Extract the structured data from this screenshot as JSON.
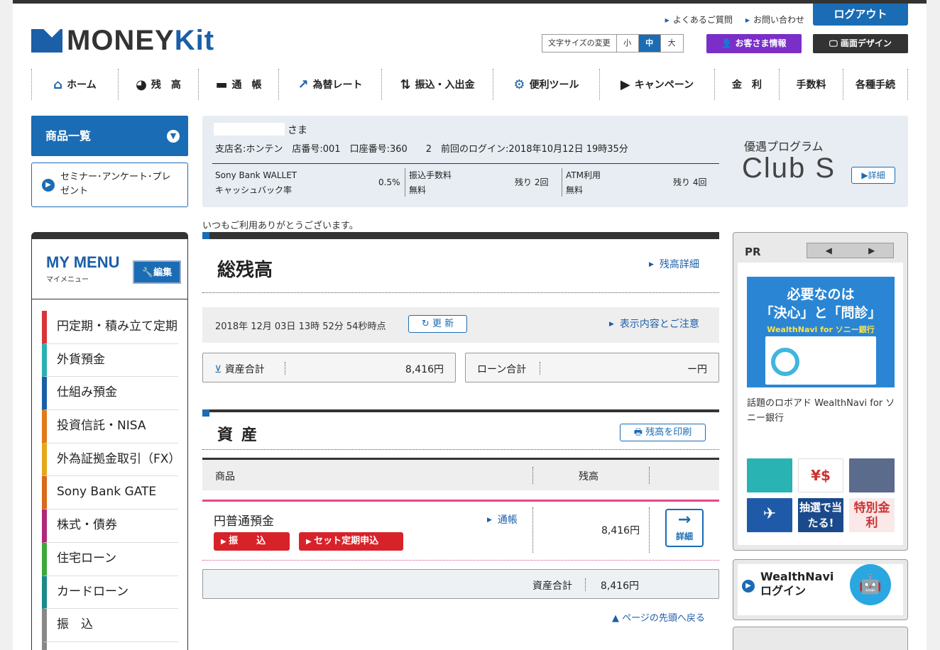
{
  "header": {
    "logo_money": "MONEY",
    "logo_kit": "Kit",
    "top_links": [
      "よくあるご質問",
      "お問い合わせ"
    ],
    "logout": "ログアウト",
    "font_size_label": "文字サイズの変更",
    "font_size_options": [
      "小",
      "中",
      "大"
    ],
    "font_size_selected": "中",
    "customer_info": "お客さま情報",
    "screen_design": "画面デザイン"
  },
  "nav": [
    {
      "label": "ホーム",
      "icon": "home-icon",
      "glyph": "⌂"
    },
    {
      "label": "残　高",
      "icon": "pie-chart-icon",
      "glyph": "◕"
    },
    {
      "label": "通　帳",
      "icon": "passbook-icon",
      "glyph": "▬"
    },
    {
      "label": "為替レート",
      "icon": "exchange-chart-icon",
      "glyph": "↗"
    },
    {
      "label": "振込・入出金",
      "icon": "transfer-arrows-icon",
      "glyph": "⇅"
    },
    {
      "label": "便利ツール",
      "icon": "gear-icon",
      "glyph": "⚙"
    },
    {
      "label": "キャンペーン",
      "icon": "megaphone-icon",
      "glyph": "▶"
    },
    {
      "label": "金　利",
      "icon": "",
      "glyph": ""
    },
    {
      "label": "手数料",
      "icon": "",
      "glyph": ""
    },
    {
      "label": "各種手続",
      "icon": "",
      "glyph": ""
    }
  ],
  "sidebar": {
    "product_list": "商品一覧",
    "seminar": "セミナー･アンケート･プレゼント",
    "mymenu_title": "MY MENU",
    "mymenu_sub": "マイメニュー",
    "edit": "編集",
    "items": [
      {
        "label": "円定期・積み立て定期",
        "color": "#d9343a"
      },
      {
        "label": "外貨預金",
        "color": "#2bb0b0"
      },
      {
        "label": "仕組み預金",
        "color": "#1a5fa8"
      },
      {
        "label": "投資信託・NISA",
        "color": "#e07a1a"
      },
      {
        "label": "外為証拠金取引（FX）",
        "color": "#e6a81a"
      },
      {
        "label": "Sony Bank GATE",
        "color": "#d86a1a"
      },
      {
        "label": "株式・債券",
        "color": "#b0287a"
      },
      {
        "label": "住宅ローン",
        "color": "#3aaa3a"
      },
      {
        "label": "カードローン",
        "color": "#1a8a8a"
      },
      {
        "label": "振　込",
        "color": "#888888"
      },
      {
        "label": "",
        "color": "#888888"
      }
    ]
  },
  "welcome": {
    "honorific": "さま",
    "account_line": "支店名:ホンテン　店番号:001　口座番号:360　　2　前回のログイン:2018年10月12日 19時35分",
    "wallet_label_1": "Sony Bank WALLET",
    "wallet_label_2": "キャッシュバック率",
    "wallet_rate": "0.5%",
    "transfer_label": "振込手数料",
    "transfer_sub": "無料",
    "transfer_remaining": "残り 2回",
    "atm_label": "ATM利用",
    "atm_sub": "無料",
    "atm_remaining": "残り 4回",
    "program_label": "優遇プログラム",
    "program_name": "Club S",
    "program_detail": "詳細"
  },
  "thanks": "いつもご利用ありがとうございます。",
  "balance": {
    "title": "総残高",
    "detail_link": "残高詳細",
    "timestamp": "2018年 12月 03日  13時 52分 54秒時点",
    "update": "更 新",
    "notice_link": "表示内容とご注意",
    "asset_total_label": "資産合計",
    "asset_total_value": "8,416円",
    "loan_total_label": "ローン合計",
    "loan_total_value": "ー円"
  },
  "assets": {
    "title": "資産",
    "print": "残高を印刷",
    "col_product": "商品",
    "col_balance": "残高",
    "row_name": "円普通預金",
    "row_link": "通帳",
    "row_value": "8,416円",
    "btn_transfer": "振　　込",
    "btn_fixed": "セット定期申込",
    "btn_detail": "詳細",
    "total_label": "資産合計",
    "total_value": "8,416円",
    "page_top": "ページの先頭へ戻る"
  },
  "right": {
    "pr_label": "PR",
    "banner_line1": "必要なのは",
    "banner_line2": "「決心」と「問診」",
    "banner_line3": "WealthNavi for ソニー銀行",
    "caption": "話題のロボアド WealthNavi for ソニー銀行",
    "thumb_lottery": "抽選で当たる!",
    "thumb_special": "特別金利",
    "thumb_currency": "¥$",
    "wealthnavi": "WealthNavi ログイン"
  }
}
